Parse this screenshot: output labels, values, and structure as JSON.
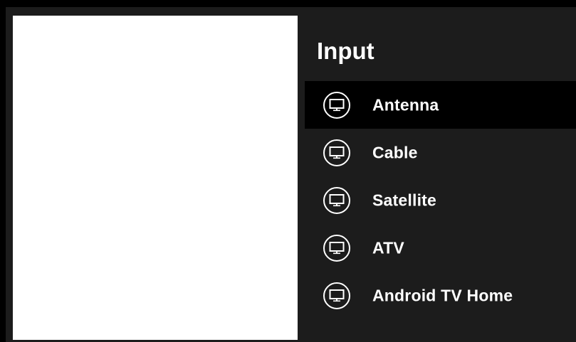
{
  "panel": {
    "title": "Input"
  },
  "menu": {
    "items": [
      {
        "label": "Antenna",
        "icon": "tv-icon",
        "focused": true
      },
      {
        "label": "Cable",
        "icon": "tv-icon",
        "focused": false
      },
      {
        "label": "Satellite",
        "icon": "tv-icon",
        "focused": false
      },
      {
        "label": "ATV",
        "icon": "tv-icon",
        "focused": false
      },
      {
        "label": "Android TV Home",
        "icon": "tv-icon",
        "focused": false
      }
    ]
  },
  "colors": {
    "panel_background": "#1c1c1c",
    "focused_background": "#000000",
    "text": "#ffffff",
    "preview_background": "#ffffff"
  }
}
